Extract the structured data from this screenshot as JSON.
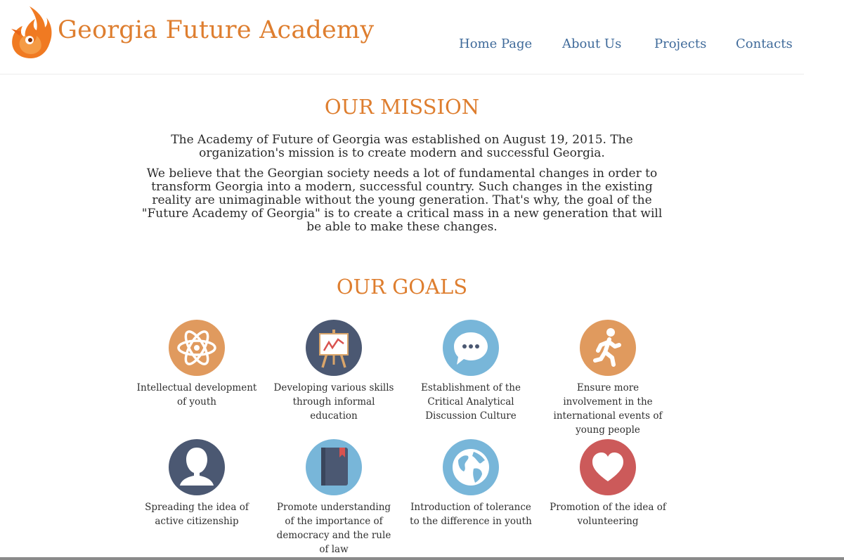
{
  "header": {
    "brand": "Georgia Future Academy",
    "nav": [
      "Home Page",
      "About Us",
      "Projects",
      "Contacts"
    ]
  },
  "mission": {
    "title": "OUR MISSION",
    "paragraphs": [
      "The Academy of Future of Georgia was established on August 19, 2015. The organization's mission is to create modern and successful Georgia.",
      "We believe that the Georgian society needs a lot of fundamental changes in order to transform Georgia into a modern, successful country. Such changes in the existing reality are unimaginable without the young generation. That's why, the goal of the \"Future Academy of Georgia\" is to create a critical mass in a new generation that will be able to make these changes."
    ]
  },
  "goals": {
    "title": "OUR GOALS",
    "items": [
      {
        "label": "Intellectual development of youth",
        "icon": "atom-icon",
        "color": "#e09a5e"
      },
      {
        "label": "Developing various skills through informal education",
        "icon": "easel-icon",
        "color": "#4b5872"
      },
      {
        "label": "Establishment of the Critical Analytical Discussion Culture",
        "icon": "speech-bubble-icon",
        "color": "#78b6d9"
      },
      {
        "label": "Ensure more involvement in the international events of young people",
        "icon": "walking-person-icon",
        "color": "#e09a5e"
      },
      {
        "label": "Spreading the idea of active citizenship",
        "icon": "person-silhouette-icon",
        "color": "#4b5872"
      },
      {
        "label": "Promote understanding of the importance of democracy and the rule of law",
        "icon": "book-icon",
        "color": "#78b6d9"
      },
      {
        "label": "Introduction of tolerance to the difference in youth",
        "icon": "globe-icon",
        "color": "#78b6d9"
      },
      {
        "label": "Promotion of the idea of volunteering",
        "icon": "heart-icon",
        "color": "#cc5a5a"
      }
    ]
  },
  "colors": {
    "accent": "#de7e2f",
    "nav": "#3f6a9a"
  }
}
